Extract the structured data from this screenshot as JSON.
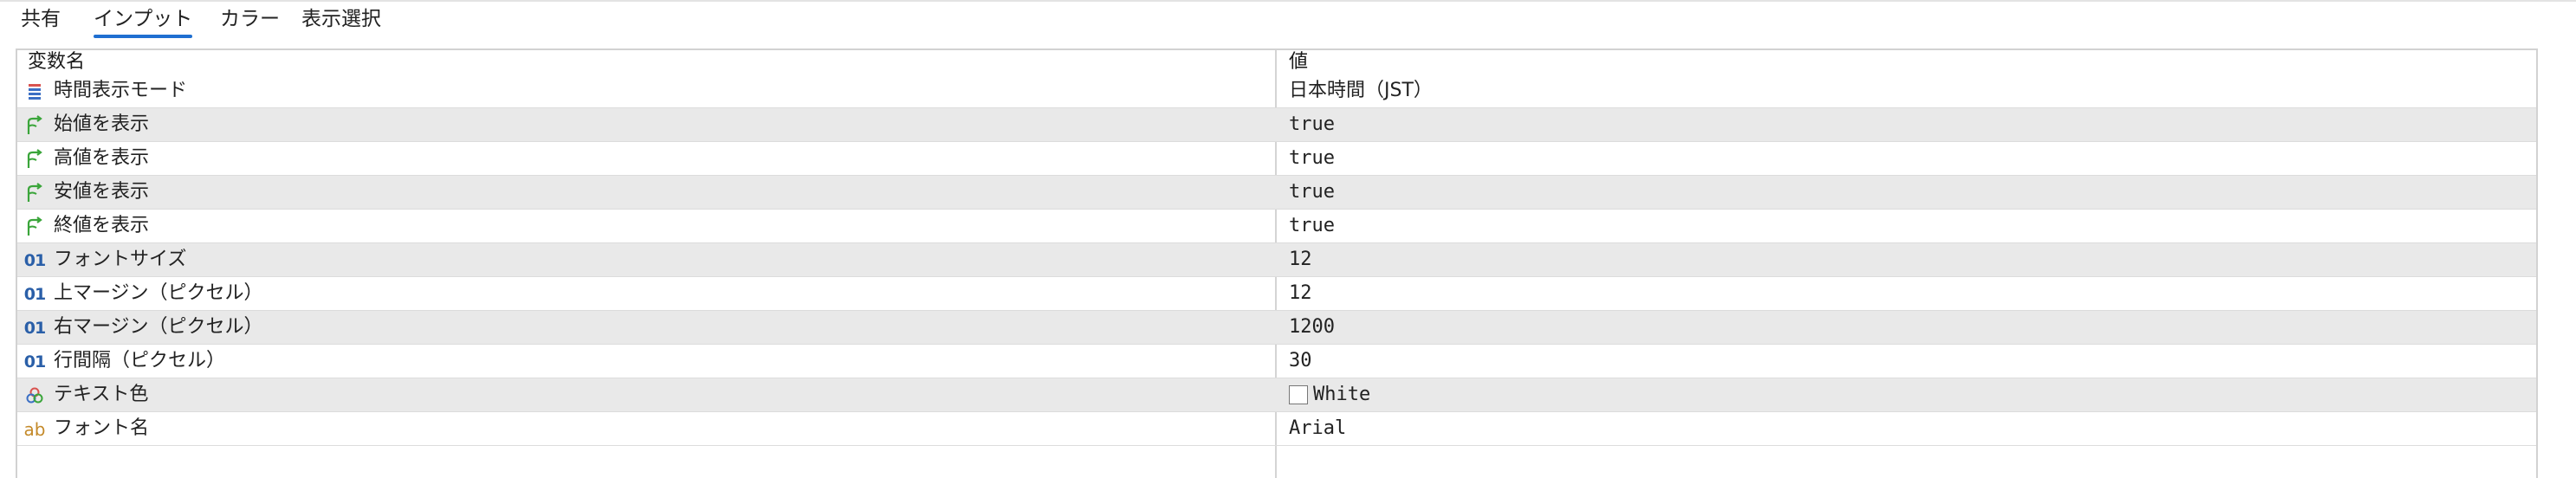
{
  "tabs": [
    "共有",
    "インプット",
    "カラー",
    "表示選択"
  ],
  "active_tab_index": 1,
  "table": {
    "header": {
      "name": "変数名",
      "value": "値"
    },
    "rows": [
      {
        "icon": "enum-list-icon",
        "name": "時間表示モード",
        "value": "日本時間（JST）"
      },
      {
        "icon": "bool-branch-icon",
        "name": "始値を表示",
        "value": "true"
      },
      {
        "icon": "bool-branch-icon",
        "name": "高値を表示",
        "value": "true"
      },
      {
        "icon": "bool-branch-icon",
        "name": "安値を表示",
        "value": "true"
      },
      {
        "icon": "bool-branch-icon",
        "name": "終値を表示",
        "value": "true"
      },
      {
        "icon": "int-01-icon",
        "icon_text": "01",
        "name": "フォントサイズ",
        "value": "12"
      },
      {
        "icon": "int-01-icon",
        "icon_text": "01",
        "name": "上マージン（ピクセル）",
        "value": "12"
      },
      {
        "icon": "int-01-icon",
        "icon_text": "01",
        "name": "右マージン（ピクセル）",
        "value": "1200"
      },
      {
        "icon": "int-01-icon",
        "icon_text": "01",
        "name": "行間隔（ピクセル）",
        "value": "30"
      },
      {
        "icon": "color-circles-icon",
        "name": "テキスト色",
        "value": "White",
        "swatch_color": "#ffffff"
      },
      {
        "icon": "string-ab-icon",
        "icon_text": "ab",
        "name": "フォント名",
        "value": "Arial"
      }
    ]
  },
  "colors": {
    "accent": "#1f6fd1",
    "row_alt": "#e9e9e9",
    "bool_icon": "#3aa53a",
    "int_icon": "#2a5fa8",
    "string_icon": "#c48a2a"
  }
}
